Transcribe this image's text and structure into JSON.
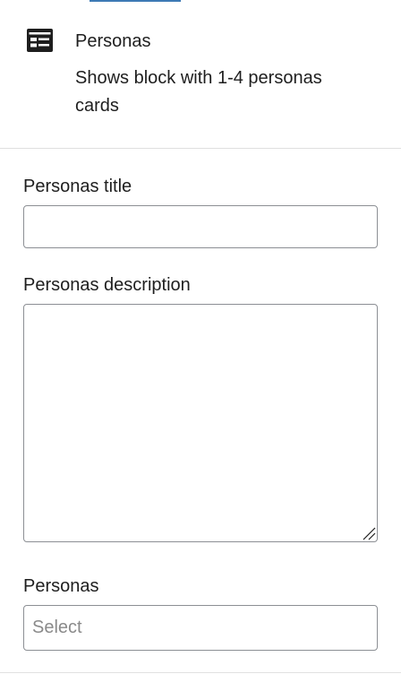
{
  "block": {
    "icon": "table-layout-icon",
    "title": "Personas",
    "description": "Shows block with 1-4 personas cards"
  },
  "fields": {
    "title_label": "Personas title",
    "title_value": "",
    "description_label": "Personas description",
    "description_value": "",
    "personas_label": "Personas",
    "personas_placeholder": "Select"
  },
  "colors": {
    "accent": "#3d7ab5",
    "border": "#8c8f94",
    "divider": "#e0e0e0",
    "text": "#1e1e1e",
    "placeholder": "#8a8a8a"
  }
}
